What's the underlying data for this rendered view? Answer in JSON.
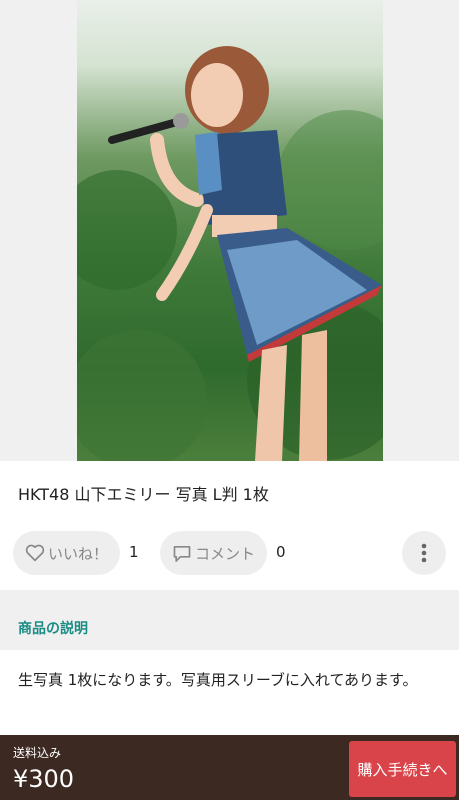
{
  "product": {
    "title": "HKT48 山下エミリー 写真 L判 1枚",
    "photo_icon": "product-photo"
  },
  "actions": {
    "like_label": "いいね！",
    "like_count": "1",
    "comment_label": "コメント",
    "comment_count": "0",
    "more_icon": "more-vertical-icon"
  },
  "description": {
    "header": "商品の説明",
    "text": "生写真 1枚になります。写真用スリーブに入れてあります。"
  },
  "purchase": {
    "shipping_label": "送料込み",
    "price": "¥300",
    "button_label": "購入手続きへ"
  },
  "colors": {
    "accent_teal": "#1a8c84",
    "buy_red": "#d8444a",
    "bar_brown": "#3c2a22"
  }
}
